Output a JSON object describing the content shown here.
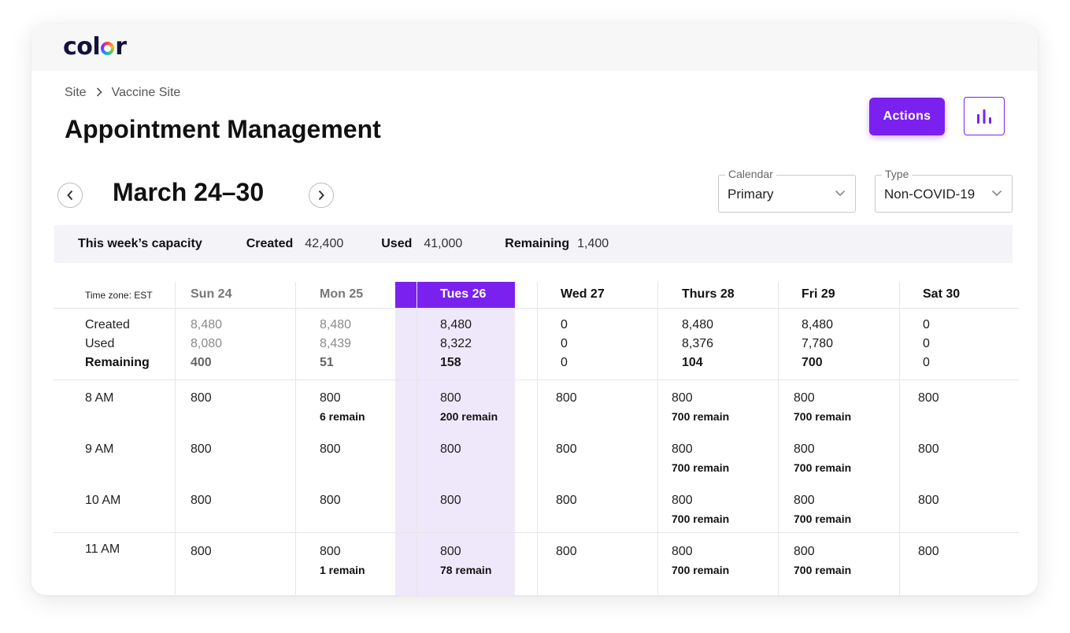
{
  "app": {
    "logo_text_a": "col",
    "logo_text_b": "r"
  },
  "breadcrumb": {
    "items": [
      "Site",
      "Vaccine Site"
    ],
    "separator": ">"
  },
  "page_title": "Appointment Management",
  "toolbar": {
    "actions_label": "Actions",
    "chart_icon": "bar-chart-icon"
  },
  "week": {
    "title": "March 24–30",
    "prev_icon": "chevron-left-icon",
    "next_icon": "chevron-right-icon"
  },
  "filters": {
    "calendar": {
      "label": "Calendar",
      "value": "Primary"
    },
    "type": {
      "label": "Type",
      "value": "Non-COVID-19"
    }
  },
  "capacity": {
    "title": "This week’s capacity",
    "created_label": "Created",
    "created_value": "42,400",
    "used_label": "Used",
    "used_value": "41,000",
    "remaining_label": "Remaining",
    "remaining_value": "1,400"
  },
  "table": {
    "timezone": "Time zone: EST",
    "days": [
      "Sun 24",
      "Mon 25",
      "Tues 26",
      "Wed 27",
      "Thurs 28",
      "Fri 29",
      "Sat 30"
    ],
    "summary_labels": [
      "Created",
      "Used",
      "Remaining"
    ],
    "summary": [
      {
        "created": "8,480",
        "used": "8,080",
        "remaining": "400"
      },
      {
        "created": "8,480",
        "used": "8,439",
        "remaining": "51"
      },
      {
        "created": "8,480",
        "used": "8,322",
        "remaining": "158"
      },
      {
        "created": "0",
        "used": "0",
        "remaining": "0"
      },
      {
        "created": "8,480",
        "used": "8,376",
        "remaining": "104"
      },
      {
        "created": "8,480",
        "used": "7,780",
        "remaining": "700"
      },
      {
        "created": "0",
        "used": "0",
        "remaining": "0"
      }
    ],
    "slots": [
      {
        "time": "8 AM",
        "cells": [
          {
            "value": "800",
            "remain": ""
          },
          {
            "value": "800",
            "remain": "6 remain"
          },
          {
            "value": "800",
            "remain": "200 remain"
          },
          {
            "value": "800",
            "remain": ""
          },
          {
            "value": "800",
            "remain": "700 remain"
          },
          {
            "value": "800",
            "remain": "700 remain"
          },
          {
            "value": "800",
            "remain": ""
          }
        ]
      },
      {
        "time": "9 AM",
        "cells": [
          {
            "value": "800",
            "remain": ""
          },
          {
            "value": "800",
            "remain": ""
          },
          {
            "value": "800",
            "remain": ""
          },
          {
            "value": "800",
            "remain": ""
          },
          {
            "value": "800",
            "remain": "700 remain"
          },
          {
            "value": "800",
            "remain": "700 remain"
          },
          {
            "value": "800",
            "remain": ""
          }
        ]
      },
      {
        "time": "10 AM",
        "cells": [
          {
            "value": "800",
            "remain": ""
          },
          {
            "value": "800",
            "remain": ""
          },
          {
            "value": "800",
            "remain": ""
          },
          {
            "value": "800",
            "remain": ""
          },
          {
            "value": "800",
            "remain": "700 remain"
          },
          {
            "value": "800",
            "remain": "700 remain"
          },
          {
            "value": "800",
            "remain": ""
          }
        ]
      },
      {
        "time": "11 AM",
        "cells": [
          {
            "value": "800",
            "remain": ""
          },
          {
            "value": "800",
            "remain": "1 remain"
          },
          {
            "value": "800",
            "remain": "78 remain"
          },
          {
            "value": "800",
            "remain": ""
          },
          {
            "value": "800",
            "remain": "700 remain"
          },
          {
            "value": "800",
            "remain": "700 remain"
          },
          {
            "value": "800",
            "remain": ""
          }
        ]
      }
    ]
  },
  "colors": {
    "accent": "#7a21ef",
    "highlight": "#efe8fb",
    "capacity_bg": "#f3f3f8"
  }
}
